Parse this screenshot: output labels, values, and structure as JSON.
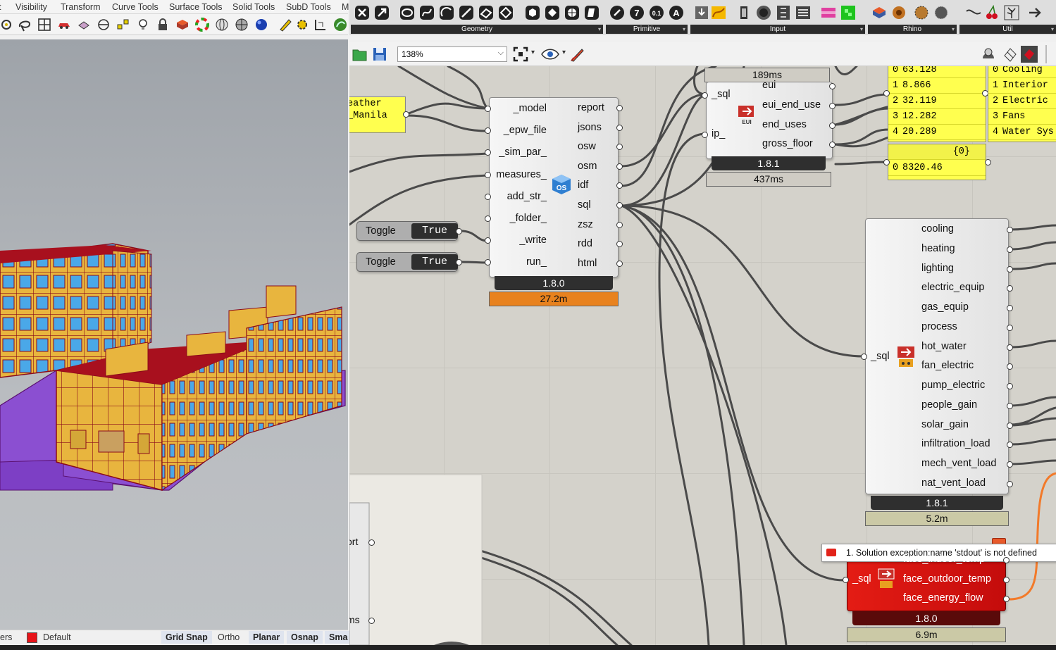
{
  "rhino": {
    "tabs": [
      "t",
      "Visibility",
      "Transform",
      "Curve Tools",
      "Surface Tools",
      "Solid Tools",
      "SubD Tools",
      "M"
    ],
    "status": {
      "layers_fragment": "ers",
      "layer_name": "Default",
      "layer_color": "#e8141a",
      "grid_snap": "Grid Snap",
      "ortho": "Ortho",
      "planar": "Planar",
      "osnap": "Osnap",
      "smarttrack_fragment": "Sma"
    }
  },
  "gh": {
    "ribbon_groups": [
      "Geometry",
      "Primitive",
      "Input",
      "Rhino",
      "Util"
    ],
    "zoom": "138%",
    "run_comp": {
      "inputs": [
        "_model",
        "_epw_file",
        "_sim_par_",
        "measures_",
        "add_str_",
        "_folder_",
        "_write",
        "run_"
      ],
      "outputs": [
        "report",
        "jsons",
        "osw",
        "osm",
        "idf",
        "sql",
        "zsz",
        "rdd",
        "html"
      ],
      "version": "1.8.0",
      "time": "27.2m"
    },
    "weather_panel": {
      "lines": [
        "eather",
        "_Manila"
      ]
    },
    "toggles": [
      {
        "label": "Toggle",
        "value": "True"
      },
      {
        "label": "Toggle",
        "value": "True"
      }
    ],
    "eui_comp": {
      "inputs": [
        "_sql",
        "ip_"
      ],
      "outputs": [
        "eui",
        "eui_end_use",
        "end_uses",
        "gross_floor"
      ],
      "version": "1.8.1",
      "top_time": "189ms",
      "time": "437ms",
      "icon_text": "EUI"
    },
    "eui_panel": {
      "rows": [
        [
          "0",
          "63.128"
        ],
        [
          "1",
          "8.866"
        ],
        [
          "2",
          "32.119"
        ],
        [
          "3",
          "12.282"
        ],
        [
          "4",
          "20.289"
        ]
      ]
    },
    "enduse_panel": {
      "rows": [
        [
          "0",
          "Cooling"
        ],
        [
          "1",
          "Interior"
        ],
        [
          "2",
          "Electric"
        ],
        [
          "3",
          "Fans"
        ],
        [
          "4",
          "Water Sys"
        ]
      ]
    },
    "floor_panel": {
      "header": "{0}",
      "rows": [
        [
          "0",
          "8320.46"
        ]
      ]
    },
    "results_comp": {
      "input": "_sql",
      "outputs": [
        "cooling",
        "heating",
        "lighting",
        "electric_equip",
        "gas_equip",
        "process",
        "hot_water",
        "fan_electric",
        "pump_electric",
        "people_gain",
        "solar_gain",
        "infiltration_load",
        "mech_vent_load",
        "nat_vent_load"
      ],
      "version": "1.8.1",
      "time": "5.2m"
    },
    "face_comp": {
      "input": "_sql",
      "outputs": [
        "face_indoor_temp",
        "face_outdoor_temp",
        "face_energy_flow"
      ],
      "version": "1.8.0",
      "time": "6.9m"
    },
    "error_message": "1. Solution exception:name 'stdout' is not defined",
    "partial_comp": {
      "outputs": [
        "ort",
        "ms"
      ]
    }
  }
}
